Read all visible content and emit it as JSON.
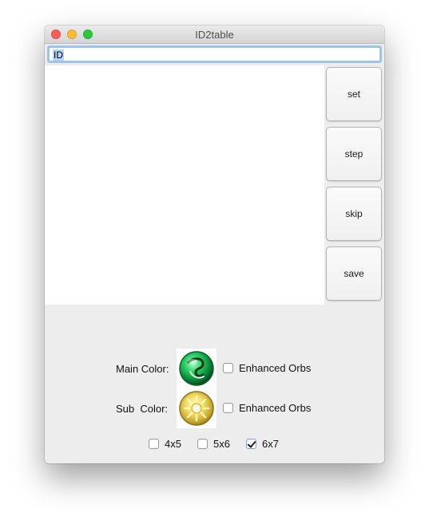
{
  "window": {
    "title": "ID2table"
  },
  "id_field": {
    "value": "ID"
  },
  "buttons": {
    "set": "set",
    "step": "step",
    "skip": "skip",
    "save": "save"
  },
  "main_color": {
    "label": "Main Color:",
    "orb_icon": "green-wood-orb-icon",
    "enhanced_label": "Enhanced Orbs",
    "enhanced_checked": false
  },
  "sub_color": {
    "label": "Sub  Color:",
    "orb_icon": "yellow-light-orb-icon",
    "enhanced_label": "Enhanced Orbs",
    "enhanced_checked": false
  },
  "board_sizes": [
    {
      "label": "4x5",
      "checked": false
    },
    {
      "label": "5x6",
      "checked": false
    },
    {
      "label": "6x7",
      "checked": true
    }
  ]
}
